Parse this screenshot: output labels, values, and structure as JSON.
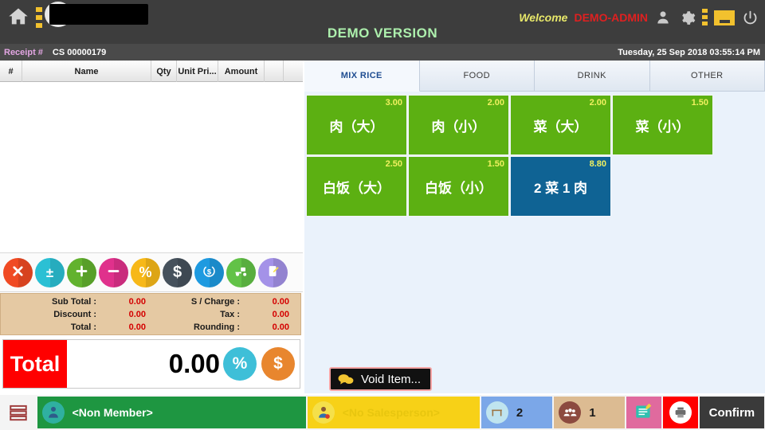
{
  "header": {
    "home_icon": "home-icon",
    "menu_icon": "vertical-dots-icon",
    "demo_version": "DEMO VERSION",
    "welcome_text": "Welcome",
    "admin_name": "DEMO-ADMIN",
    "user_icon": "user-icon",
    "settings_icon": "gear-icon",
    "more_icon": "vertical-dots-icon",
    "minimize_icon": "minimize-icon",
    "power_icon": "power-icon"
  },
  "receipt_bar": {
    "label": "Receipt #",
    "value": "CS 00000179",
    "datetime": "Tuesday, 25 Sep 2018 03:55:14 PM"
  },
  "receipt_table": {
    "columns": [
      "#",
      "Name",
      "Qty",
      "Unit Pri...",
      "Amount",
      "",
      ""
    ],
    "rows": []
  },
  "action_buttons": [
    {
      "name": "void-button",
      "glyph": "✖",
      "color": "#f04a23"
    },
    {
      "name": "plus-minus-button",
      "glyph": "±",
      "color": "#2bc0d4"
    },
    {
      "name": "add-qty-button",
      "glyph": "+",
      "color": "#62b22e"
    },
    {
      "name": "minus-qty-button",
      "glyph": "−",
      "color": "#e0318c"
    },
    {
      "name": "discount-button",
      "glyph": "%",
      "color": "#f7b818"
    },
    {
      "name": "price-button",
      "glyph": "$",
      "color": "#46515c"
    },
    {
      "name": "refund-button",
      "glyph": "$",
      "color": "#1e9ae0"
    },
    {
      "name": "delivery-button",
      "glyph": "🛵",
      "color": "#62c247"
    },
    {
      "name": "remark-button",
      "glyph": "📝",
      "color": "#a492e8"
    }
  ],
  "summary": {
    "rows_left": [
      {
        "label": "Sub Total :",
        "value": "0.00"
      },
      {
        "label": "Discount :",
        "value": "0.00"
      },
      {
        "label": "Total :",
        "value": "0.00"
      }
    ],
    "rows_right": [
      {
        "label": "S / Charge :",
        "value": "0.00"
      },
      {
        "label": "Tax :",
        "value": "0.00"
      },
      {
        "label": "Rounding :",
        "value": "0.00"
      }
    ]
  },
  "total_bar": {
    "label": "Total",
    "amount": "0.00",
    "percent_glyph": "%",
    "dollar_glyph": "$"
  },
  "tabs": [
    {
      "label": "MIX RICE",
      "active": true
    },
    {
      "label": "FOOD",
      "active": false
    },
    {
      "label": "DRINK",
      "active": false
    },
    {
      "label": "OTHER",
      "active": false
    }
  ],
  "products": [
    {
      "name": "肉（大）",
      "price": "3.00",
      "color": "green",
      "col": 0,
      "row": 0
    },
    {
      "name": "肉（小）",
      "price": "2.00",
      "color": "green",
      "col": 1,
      "row": 0
    },
    {
      "name": "菜（大）",
      "price": "2.00",
      "color": "green",
      "col": 2,
      "row": 0
    },
    {
      "name": "菜（小）",
      "price": "1.50",
      "color": "green",
      "col": 3,
      "row": 0
    },
    {
      "name": "白饭（大）",
      "price": "2.50",
      "color": "green",
      "col": 0,
      "row": 1
    },
    {
      "name": "白饭（小）",
      "price": "1.50",
      "color": "green",
      "col": 1,
      "row": 1
    },
    {
      "name": "2 菜 1 肉",
      "price": "8.80",
      "color": "blue",
      "col": 2,
      "row": 1
    }
  ],
  "tooltip": {
    "text": "Void Item...",
    "icon": "speech-bubble-icon"
  },
  "bottom_bar": {
    "menu_icon": "list-menu-icon",
    "member_label": "<Non Member>",
    "member_icon": "member-avatar-icon",
    "salesperson_label": "<No Salesperson>",
    "salesperson_icon": "salesperson-avatar-icon",
    "table_count": "2",
    "table_icon": "table-icon",
    "pax_count": "1",
    "pax_icon": "people-icon",
    "notes_icon": "notes-icon",
    "print_icon": "printer-icon",
    "confirm_label": "Confirm"
  },
  "colors": {
    "topbar": "#3d3d3d",
    "demo_green": "#adf0ad",
    "admin_red": "#e02020",
    "welcome_yellow": "#e8e86a",
    "accent_yellow": "#f2c12e",
    "tile_green": "#5cb012",
    "tile_blue": "#0f6394",
    "total_red": "#ff0000",
    "summary_tan": "#e5c9a3",
    "member_green": "#1e9641",
    "salesperson_yellow": "#f7d117"
  }
}
